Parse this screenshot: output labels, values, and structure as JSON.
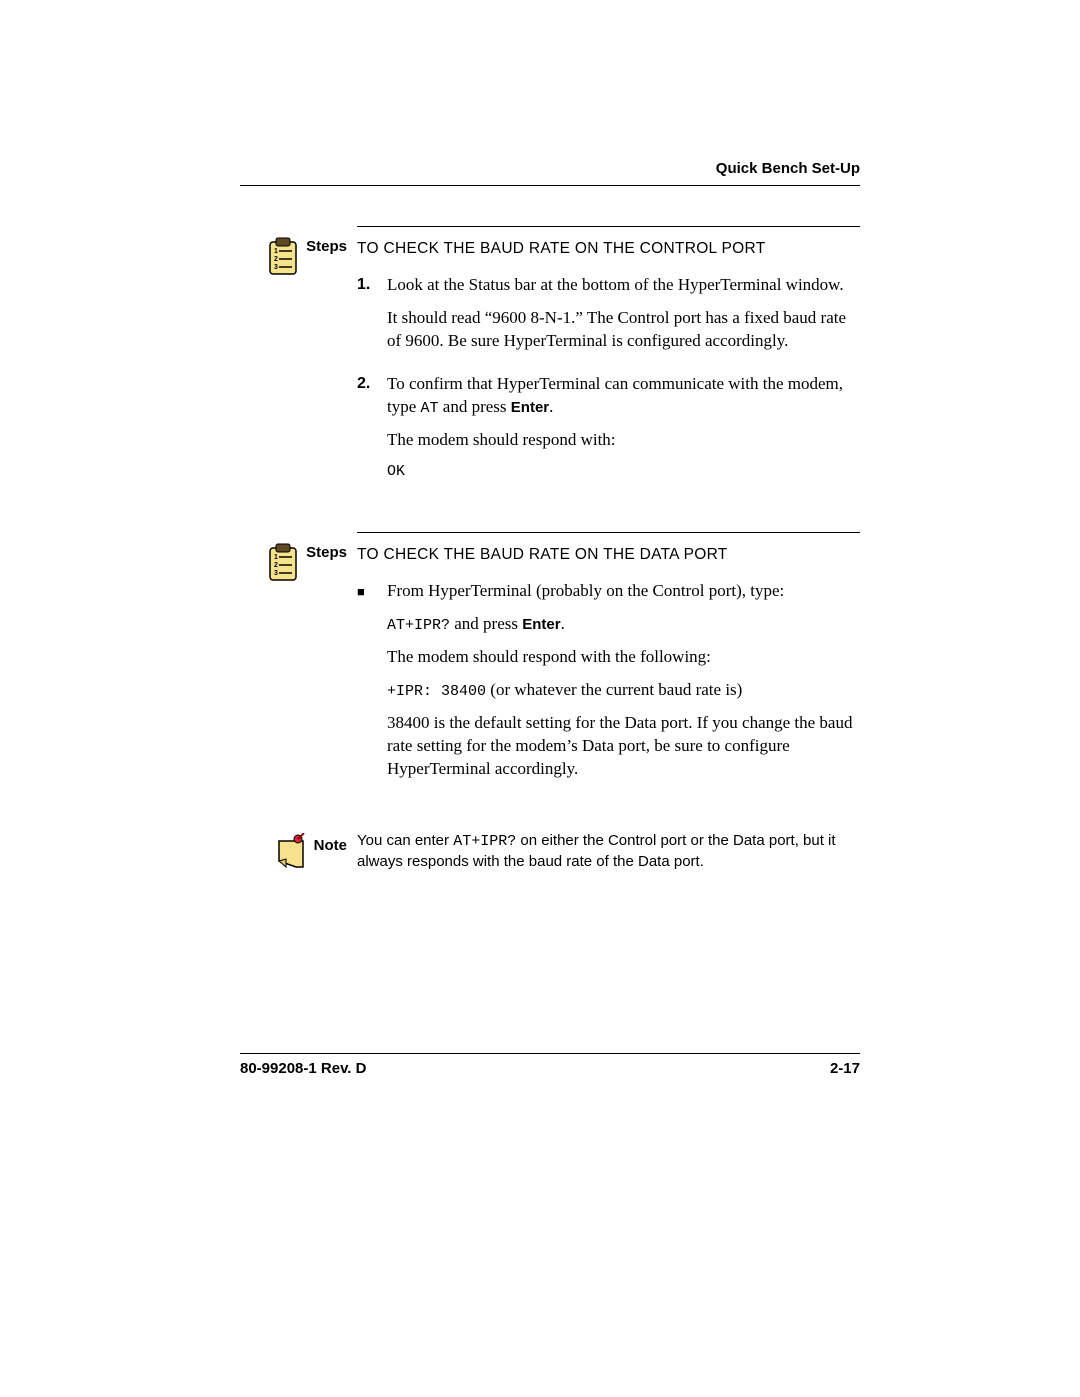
{
  "header": {
    "title": "Quick Bench Set-Up"
  },
  "labels": {
    "steps": "Steps",
    "note": "Note"
  },
  "section1": {
    "heading": "TO CHECK THE BAUD RATE ON THE CONTROL PORT",
    "items": [
      {
        "num": "1.",
        "p1": "Look at the Status bar at the bottom of the HyperTerminal window.",
        "p2": "It should read “9600 8-N-1.” The Control port has a fixed baud rate of 9600. Be sure HyperTerminal is configured accordingly."
      },
      {
        "num": "2.",
        "p1a": "To confirm that HyperTerminal can communicate with the modem, type ",
        "cmd": "AT",
        "p1b": " and press ",
        "enter": "Enter",
        "p1c": ".",
        "p2": "The modem should respond with:",
        "resp": "OK"
      }
    ]
  },
  "section2": {
    "heading": "TO CHECK THE BAUD RATE ON THE DATA PORT",
    "bullet": {
      "p1": "From HyperTerminal (probably on the Control port), type:",
      "cmd": "AT+IPR?",
      "p2a": " and press ",
      "enter": "Enter",
      "p2b": ".",
      "p3": "The modem should respond with the following:",
      "resp": "+IPR: 38400",
      "p4": " (or whatever the current baud rate is)",
      "p5": "38400 is the default setting for the Data port. If you change the baud rate setting for the modem’s Data port, be sure to configure HyperTerminal accordingly."
    }
  },
  "note": {
    "t1": "You can enter ",
    "cmd": "AT+IPR?",
    "t2": " on either the Control port or the Data port, but it always responds with the baud rate of the Data port."
  },
  "footer": {
    "left": "80-99208-1 Rev. D",
    "right": "2-17"
  }
}
